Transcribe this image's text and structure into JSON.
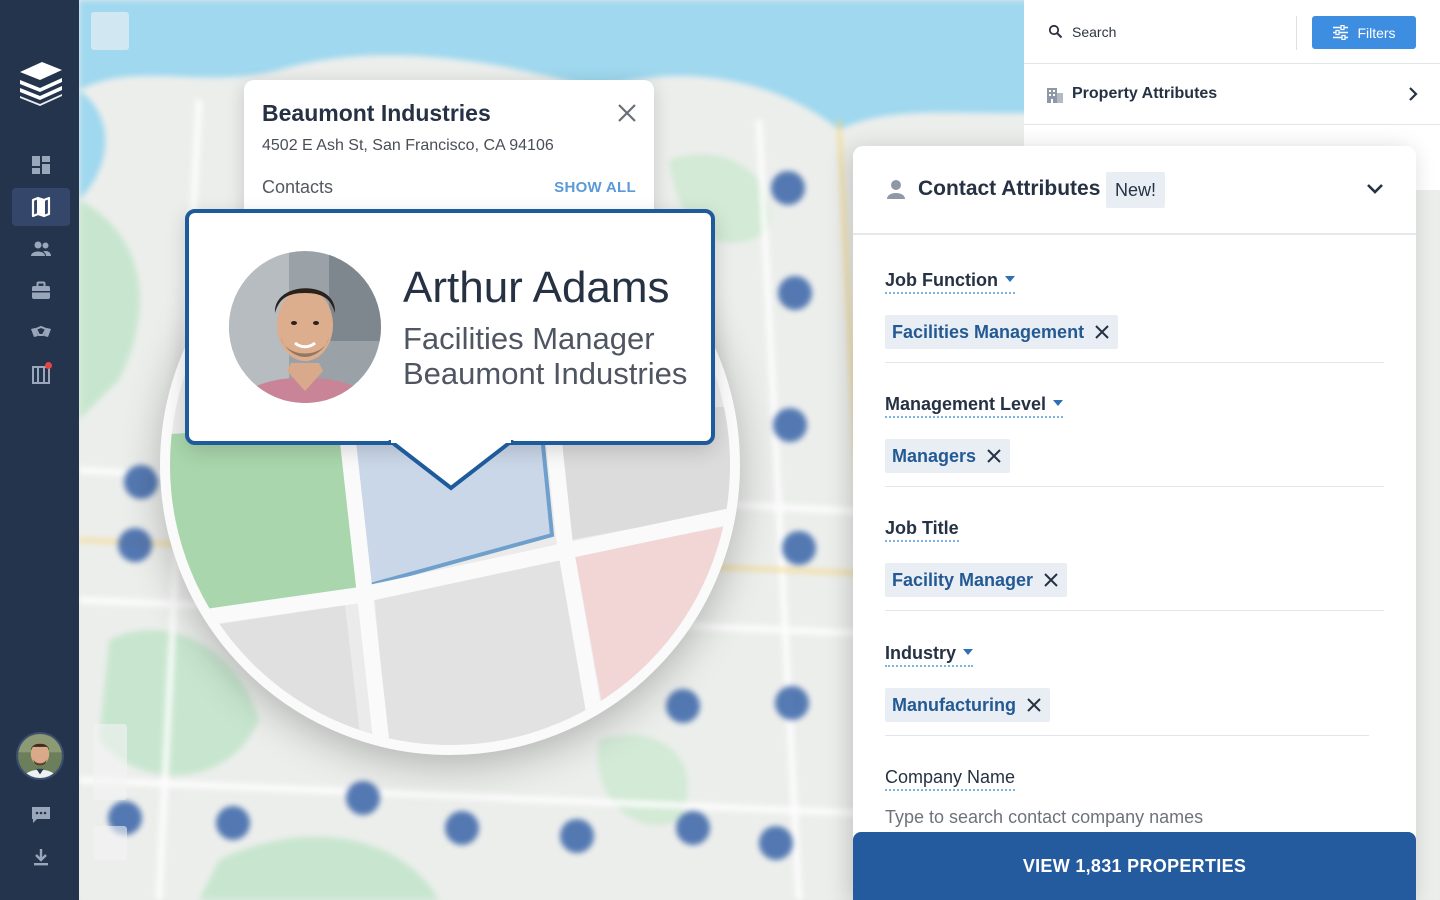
{
  "nav": {
    "items": [
      {
        "icon": "dashboard-icon",
        "active": false
      },
      {
        "icon": "map-icon",
        "active": true
      },
      {
        "icon": "people-icon",
        "active": false
      },
      {
        "icon": "briefcase-icon",
        "active": false
      },
      {
        "icon": "handshake-icon",
        "active": false
      },
      {
        "icon": "building-list-icon",
        "active": false,
        "notification": true
      }
    ],
    "bottom": [
      "chat-icon",
      "download-icon"
    ]
  },
  "popover": {
    "title": "Beaumont Industries",
    "address": "4502 E Ash St, San Francisco, CA 94106",
    "contacts_label": "Contacts",
    "show_all": "SHOW ALL"
  },
  "contact_card": {
    "name": "Arthur Adams",
    "role": "Facilities Manager",
    "company": "Beaumont Industries"
  },
  "search": {
    "label": "Search",
    "filters_label": "Filters"
  },
  "property_attributes": {
    "label": "Property Attributes"
  },
  "contact_attributes": {
    "title": "Contact Attributes",
    "badge": "New!",
    "fields": [
      {
        "label": "Job Function",
        "chip": "Facilities Management"
      },
      {
        "label": "Management Level",
        "chip": "Managers"
      },
      {
        "label": "Job Title",
        "chip": "Facility Manager"
      },
      {
        "label": "Industry",
        "chip": "Manufacturing"
      }
    ],
    "company_name": {
      "label": "Company Name",
      "placeholder": "Type to search contact company names"
    }
  },
  "cta": {
    "label": "VIEW 1,831 PROPERTIES"
  },
  "colors": {
    "nav_bg": "#25344d",
    "accent_blue": "#3d8ee0",
    "card_border": "#1e5b9c",
    "cta_bg": "#245a9e",
    "chip_text": "#245a94"
  }
}
